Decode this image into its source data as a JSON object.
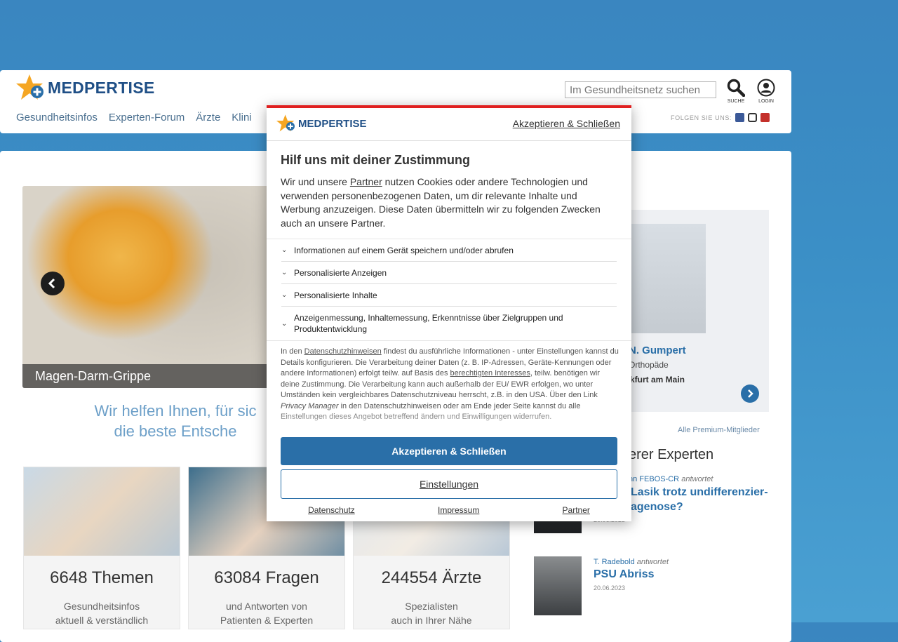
{
  "header": {
    "logo_text": "MEDPERTISE",
    "search_placeholder": "Im Gesundheitsnetz suchen",
    "search_label": "SUCHE",
    "login_label": "LOGIN",
    "follow_label": "FOLGEN SIE UNS:",
    "nav": [
      "Gesundheitsinfos",
      "Experten-Forum",
      "Ärzte",
      "Klini"
    ]
  },
  "slider": {
    "caption": "Magen-Darm-Grippe"
  },
  "tagline": {
    "line1": "Wir helfen Ihnen, für sic",
    "line2": "die beste Entsche"
  },
  "tiles": [
    {
      "count": "6648 Themen",
      "line1": "Gesundheitsinfos",
      "line2": "aktuell & verständlich"
    },
    {
      "count": "63084 Fragen",
      "line1": "und Antworten von",
      "line2": "Patienten & Experten"
    },
    {
      "count": "244554 Ärzte",
      "line1": "Spezialisten",
      "line2": "auch in Ihrer Nähe"
    }
  ],
  "expert": {
    "name": "N. Gumpert",
    "role": "Orthopäde",
    "city": "ankfurt am Main"
  },
  "all_premium": "Alle Premium-Mitglieder",
  "section_heading": "erer Experten",
  "qa": [
    {
      "author": "nn FEBOS-CR",
      "answers": "antwortet",
      "title_line1": "Lasik trotz undifferenzier-",
      "title_line2": "agenose?",
      "date": "20.06.2023"
    },
    {
      "author": "T. Radebold",
      "answers": "antwortet",
      "title_line1": "PSU Abriss",
      "title_line2": "",
      "date": "20.06.2023"
    }
  ],
  "consent": {
    "logo_text": "MEDPERTISE",
    "accept_link": "Akzeptieren & Schließen",
    "title": "Hilf uns mit deiner Zustimmung",
    "intro_pre": "Wir und unsere ",
    "intro_partner": "Partner",
    "intro_post": " nutzen Cookies oder andere Technologien und verwenden personenbezogenen Daten, um dir relevante Inhalte und Werbung anzuzeigen. Diese Daten übermitteln wir zu folgenden Zwecken auch an unsere Partner.",
    "purposes": [
      "Informationen auf einem Gerät speichern und/oder abrufen",
      "Personalisierte Anzeigen",
      "Personalisierte Inhalte",
      "Anzeigenmessung, Inhaltemessung, Erkenntnisse über Zielgruppen und Produktentwicklung"
    ],
    "details_1": "In den ",
    "details_link1": "Datenschutzhinweisen",
    "details_2": " findest du ausführliche Informationen - unter Einstellungen kannst du Details konfigurieren. Die Verarbeitung deiner Daten (z. B. IP-Adressen, Geräte-Kennungen oder andere Informationen) erfolgt teilw. auf Basis des ",
    "details_link2": "berechtigten Interesses",
    "details_3": ", teilw. benötigen wir deine Zustimmung. Die Verarbeitung kann auch außerhalb der EU/ EWR erfolgen, wo unter Umständen kein vergleichbares Datenschutzniveau herrscht, z.B. in den USA. Über den Link ",
    "details_pm": "Privacy Manager",
    "details_4": " in den Datenschutzhinweisen oder am Ende jeder Seite kannst du alle Einstellungen dieses Angebot betreffend ändern und Einwilligungen widerrufen.",
    "accept_button": "Akzeptieren & Schließen",
    "settings_button": "Einstellungen",
    "footer_links": [
      "Datenschutz",
      "Impressum",
      "Partner"
    ]
  },
  "colors": {
    "brand_blue": "#1f4f86",
    "accent_blue": "#2a6fa8",
    "modal_top_border": "#e02020"
  }
}
